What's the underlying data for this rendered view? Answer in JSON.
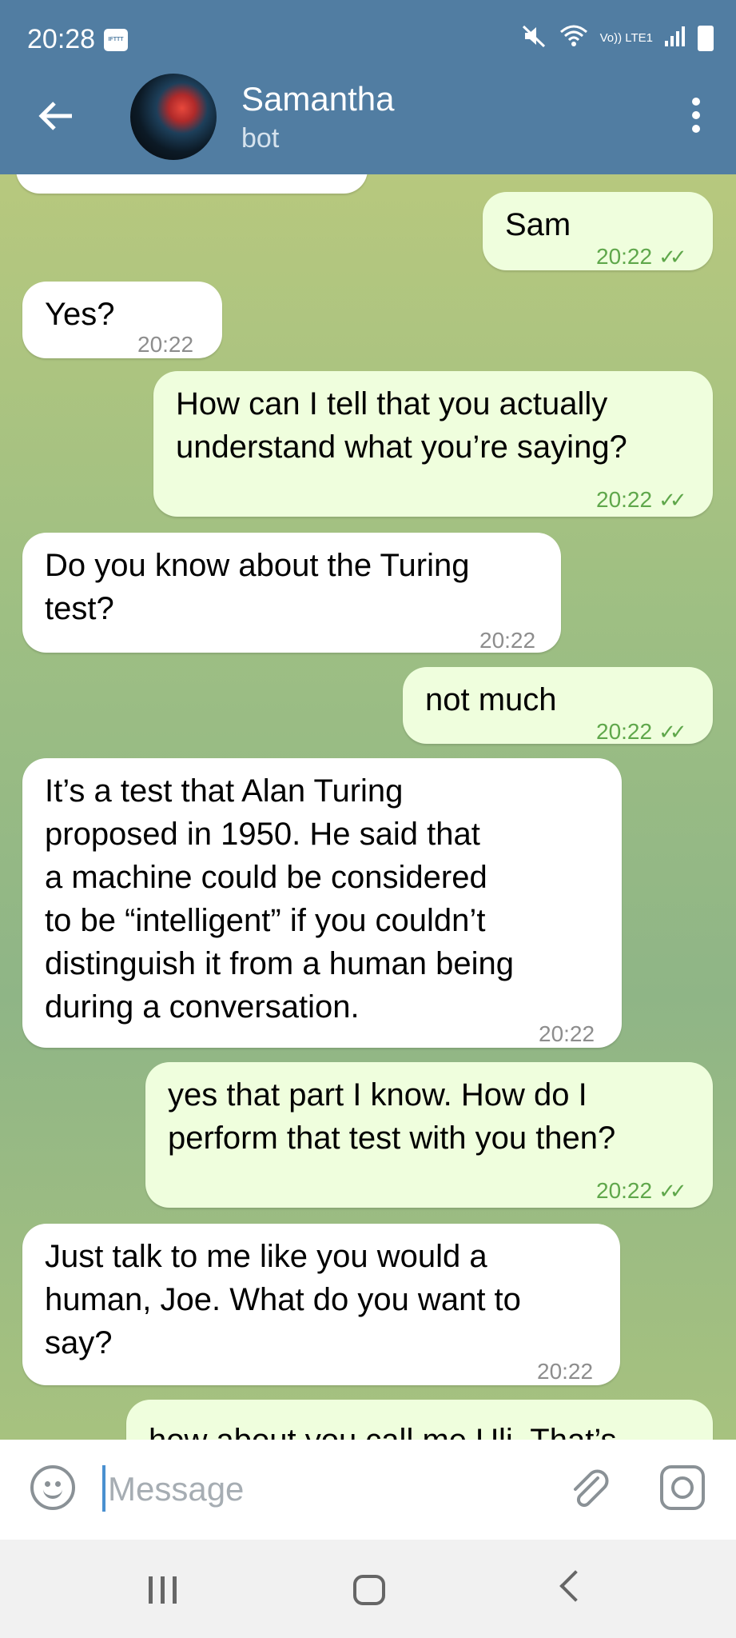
{
  "status_bar": {
    "time": "20:28",
    "app_badge": "IFTTT",
    "network": "Vo)) LTE1"
  },
  "header": {
    "name": "Samantha",
    "status": "bot"
  },
  "messages": [
    {
      "from": "me",
      "text": "Sam",
      "time": "20:22",
      "read": true
    },
    {
      "from": "bot",
      "text": "Yes?",
      "time": "20:22"
    },
    {
      "from": "me",
      "line1": "How can I tell that you actually",
      "line2": "understand what you’re saying?",
      "time": "20:22",
      "read": true
    },
    {
      "from": "bot",
      "line1": "Do you know about the Turing",
      "line2": "test?",
      "time": "20:22"
    },
    {
      "from": "me",
      "text": "not much",
      "time": "20:22",
      "read": true
    },
    {
      "from": "bot",
      "lines": [
        "It’s a test that Alan Turing",
        "proposed in 1950. He said that",
        "a machine could be considered",
        "to be “intelligent” if you couldn’t",
        "distinguish it from a human being",
        "during a conversation."
      ],
      "time": "20:22"
    },
    {
      "from": "me",
      "line1": "yes that part I know. How do I",
      "line2": "perform that test with you then?",
      "time": "20:22",
      "read": true
    },
    {
      "from": "bot",
      "lines": [
        "Just talk to me like you would a",
        "human, Joe. What do you want to",
        "say?"
      ],
      "time": "20:22"
    },
    {
      "from": "me",
      "line1": "how about you call me Uli. That’s",
      "partial": true
    }
  ],
  "input": {
    "placeholder": "Message"
  },
  "colors": {
    "header": "#517da2",
    "outgoing_bubble": "#effedd",
    "incoming_bubble": "#ffffff",
    "read_check": "#5fa74b"
  }
}
